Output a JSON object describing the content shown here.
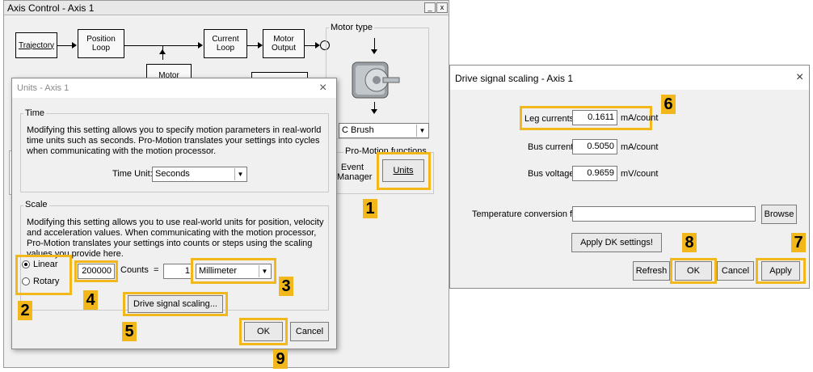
{
  "axis_window": {
    "title": "Axis Control - Axis 1",
    "min_glyph": "_",
    "close_glyph": "x",
    "blocks": {
      "trajectory": "Trajectory",
      "position_loop": "Position\nLoop",
      "current_loop": "Current\nLoop",
      "motor_output": "Motor\nOutput",
      "motor_partial": "Motor",
      "motor_type_legend": "Motor type",
      "motor_select": "C Brush",
      "promotion_legend": "Pro-Motion functions",
      "event_manager": "Event\nManager",
      "units": "Units"
    }
  },
  "units_dialog": {
    "title": "Units - Axis 1",
    "close_glyph": "×",
    "time": {
      "legend": "Time",
      "description": "Modifying this setting allows you to specify motion parameters in real-world time units such as seconds.  Pro-Motion translates your settings into cycles when communicating with the motion processor.",
      "unit_label": "Time Unit:",
      "unit_value": "Seconds"
    },
    "scale": {
      "legend": "Scale",
      "description": "Modifying this setting allows you to use real-world units for position, velocity and acceleration values.  When communicating with the motion processor, Pro-Motion translates your settings into counts or steps using the scaling values you provide here.",
      "linear_label": "Linear",
      "rotary_label": "Rotary",
      "counts_value": "200000",
      "counts_label": "Counts",
      "equals": "=",
      "units_value": "1",
      "unit_select": "Millimeter"
    },
    "drive_signal_button": "Drive signal scaling...",
    "ok_button": "OK",
    "cancel_button": "Cancel"
  },
  "drive_dialog": {
    "title": "Drive signal scaling - Axis 1",
    "close_glyph": "×",
    "leg_currents_label": "Leg currents:",
    "leg_currents_value": "0.1611",
    "leg_currents_unit": "mA/count",
    "bus_current_label": "Bus current:",
    "bus_current_value": "0.5050",
    "bus_current_unit": "mA/count",
    "bus_voltage_label": "Bus voltage:",
    "bus_voltage_value": "0.9659",
    "bus_voltage_unit": "mV/count",
    "temp_label": "Temperature conversion file:",
    "temp_value": "",
    "browse_button": "Browse",
    "apply_dk_button": "Apply DK settings!",
    "refresh_button": "Refresh",
    "ok_button": "OK",
    "cancel_button": "Cancel",
    "apply_button": "Apply"
  },
  "callouts": [
    "1",
    "2",
    "3",
    "4",
    "5",
    "6",
    "7",
    "8",
    "9"
  ],
  "colors": {
    "highlight": "#f2b71b"
  }
}
